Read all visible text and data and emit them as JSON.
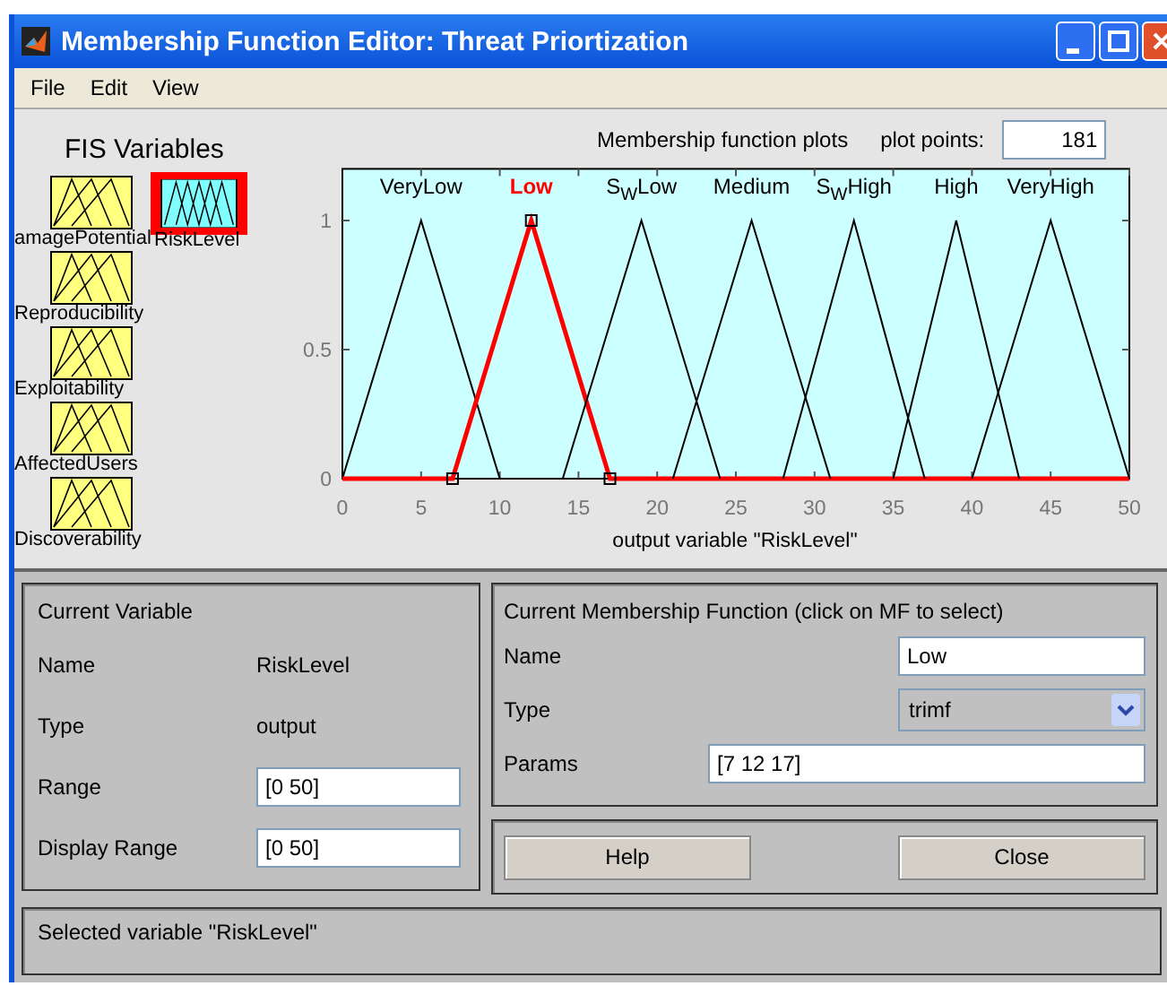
{
  "window": {
    "title": "Membership Function Editor: Threat Priortization"
  },
  "menu": [
    "File",
    "Edit",
    "View"
  ],
  "fis_variables": {
    "title": "FIS Variables",
    "items": [
      {
        "name": "amagePotential",
        "kind": "input",
        "selected": false
      },
      {
        "name": "Reproducibility",
        "kind": "input",
        "selected": false
      },
      {
        "name": "Exploitability",
        "kind": "input",
        "selected": false
      },
      {
        "name": "AffectedUsers",
        "kind": "input",
        "selected": false
      },
      {
        "name": "Discoverability",
        "kind": "input",
        "selected": false
      },
      {
        "name": "RiskLevel",
        "kind": "output",
        "selected": true
      }
    ]
  },
  "plot": {
    "title": "Membership function plots",
    "plot_points_label": "plot points:",
    "plot_points": "181",
    "chart_data": {
      "type": "line",
      "xlabel": "output variable \"RiskLevel\"",
      "x": [
        0,
        5,
        7,
        10,
        12,
        14,
        17,
        19,
        21,
        24,
        26,
        28,
        31,
        32.5,
        35,
        37,
        39,
        40,
        43,
        45,
        50
      ],
      "xlim": [
        0,
        50
      ],
      "ylim": [
        0,
        1.2
      ],
      "xticks": [
        0,
        5,
        10,
        15,
        20,
        25,
        30,
        35,
        40,
        45,
        50
      ],
      "yticks": [
        0,
        0.5,
        1
      ],
      "series": [
        {
          "name": "VeryLow",
          "color": "#000000",
          "values": [
            0,
            1,
            0.6,
            0,
            null,
            null,
            null,
            null,
            null,
            null,
            null,
            null,
            null,
            null,
            null,
            null,
            null,
            null,
            null,
            null,
            null
          ]
        },
        {
          "name": "Low",
          "color": "#ff0000",
          "values": [
            0,
            0,
            0,
            0.6,
            1,
            0.6,
            0,
            0,
            0,
            0,
            0,
            0,
            0,
            0,
            0,
            0,
            0,
            0,
            0,
            0,
            0
          ]
        },
        {
          "name": "S$_{W}$Low",
          "color": "#000000",
          "values": [
            null,
            null,
            null,
            null,
            null,
            0,
            0.6,
            1,
            0.6,
            0,
            null,
            null,
            null,
            null,
            null,
            null,
            null,
            null,
            null,
            null,
            null
          ]
        },
        {
          "name": "Medium",
          "color": "#000000",
          "values": [
            null,
            null,
            null,
            null,
            null,
            null,
            null,
            null,
            0,
            0.6,
            1,
            0.6,
            0,
            null,
            null,
            null,
            null,
            null,
            null,
            null,
            null
          ]
        },
        {
          "name": "S$_{W}$High",
          "color": "#000000",
          "values": [
            null,
            null,
            null,
            null,
            null,
            null,
            null,
            null,
            null,
            null,
            null,
            0,
            0.667,
            1,
            0.444,
            0,
            null,
            null,
            null,
            null,
            null
          ]
        },
        {
          "name": "High",
          "color": "#000000",
          "values": [
            null,
            null,
            null,
            null,
            null,
            null,
            null,
            null,
            null,
            null,
            null,
            null,
            null,
            null,
            0,
            0.5,
            1,
            0.75,
            0,
            null,
            null
          ]
        },
        {
          "name": "VeryHigh",
          "color": "#000000",
          "values": [
            null,
            null,
            null,
            null,
            null,
            null,
            null,
            null,
            null,
            null,
            null,
            null,
            null,
            null,
            null,
            null,
            null,
            0,
            0.6,
            1,
            0
          ]
        }
      ]
    }
  },
  "current_variable": {
    "title": "Current Variable",
    "name_label": "Name",
    "name": "RiskLevel",
    "type_label": "Type",
    "type": "output",
    "range_label": "Range",
    "range": "[0 50]",
    "display_range_label": "Display Range",
    "display_range": "[0 50]"
  },
  "current_mf": {
    "title": "Current Membership Function (click on MF to select)",
    "name_label": "Name",
    "name": "Low",
    "type_label": "Type",
    "type": "trimf",
    "params_label": "Params",
    "params": "[7 12 17]"
  },
  "buttons": [
    "Help",
    "Close"
  ],
  "status": "Selected variable \"RiskLevel\""
}
